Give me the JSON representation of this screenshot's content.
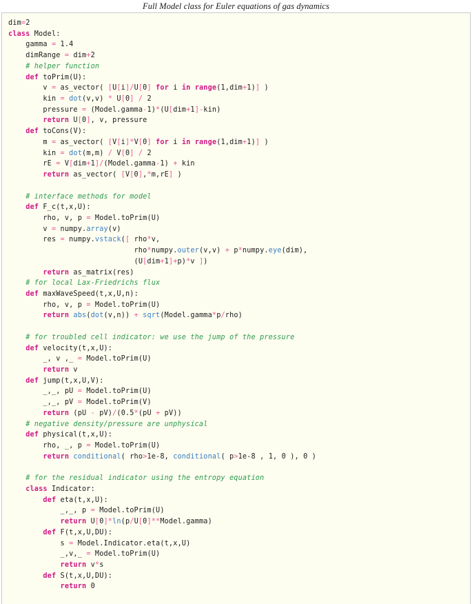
{
  "figure": {
    "caption": "Full Model class for Euler equations of gas dynamics",
    "background_color": "#fdfdf0",
    "border_color": "#c9c9c9"
  },
  "syntax_colors": {
    "keyword": "#d01884",
    "operator": "#ee5599",
    "bracket": "#ee5599",
    "builtin": "#3a7ec0",
    "comment": "#2e9b4e",
    "text": "#1c1c1c"
  },
  "code": {
    "language": "python",
    "lines": [
      "dim=2",
      "class Model:",
      "    gamma = 1.4",
      "    dimRange = dim+2",
      "    # helper function",
      "    def toPrim(U):",
      "        v = as_vector( [U[i]/U[0] for i in range(1,dim+1)] )",
      "        kin = dot(v,v) * U[0] / 2",
      "        pressure = (Model.gamma-1)*(U[dim+1]-kin)",
      "        return U[0], v, pressure",
      "    def toCons(V):",
      "        m = as_vector( [V[i]*V[0] for i in range(1,dim+1)] )",
      "        kin = dot(m,m) / V[0] / 2",
      "        rE = V[dim+1]/(Model.gamma-1) + kin",
      "        return as_vector( [V[0],*m,rE] )",
      "",
      "    # interface methods for model",
      "    def F_c(t,x,U):",
      "        rho, v, p = Model.toPrim(U)",
      "        v = numpy.array(v)",
      "        res = numpy.vstack([ rho*v,",
      "                             rho*numpy.outer(v,v) + p*numpy.eye(dim),",
      "                             (U[dim+1]+p)*v ])",
      "        return as_matrix(res)",
      "    # for local Lax-Friedrichs flux",
      "    def maxWaveSpeed(t,x,U,n):",
      "        rho, v, p = Model.toPrim(U)",
      "        return abs(dot(v,n)) + sqrt(Model.gamma*p/rho)",
      "",
      "    # for troubled cell indicator: we use the jump of the pressure",
      "    def velocity(t,x,U):",
      "        _, v ,_ = Model.toPrim(U)",
      "        return v",
      "    def jump(t,x,U,V):",
      "        _,_, pU = Model.toPrim(U)",
      "        _,_, pV = Model.toPrim(V)",
      "        return (pU - pV)/(0.5*(pU + pV))",
      "    # negative density/pressure are unphysical",
      "    def physical(t,x,U):",
      "        rho, _, p = Model.toPrim(U)",
      "        return conditional( rho>1e-8, conditional( p>1e-8 , 1, 0 ), 0 )",
      "",
      "    # for the residual indicator using the entropy equation",
      "    class Indicator:",
      "        def eta(t,x,U):",
      "            _,_, p = Model.toPrim(U)",
      "            return U[0]*ln(p/U[0]**Model.gamma)",
      "        def F(t,x,U,DU):",
      "            s = Model.Indicator.eta(t,x,U)",
      "            _,v,_ = Model.toPrim(U)",
      "            return v*s",
      "        def S(t,x,U,DU):",
      "            return 0"
    ]
  }
}
